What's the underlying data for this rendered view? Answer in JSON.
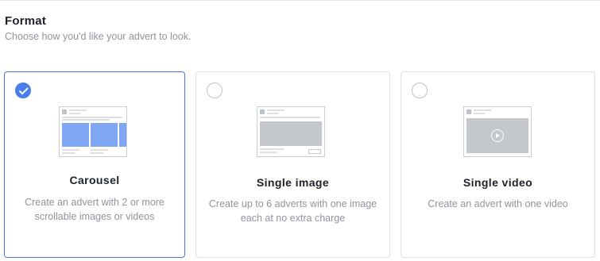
{
  "section": {
    "title": "Format",
    "subtitle": "Choose how you'd like your advert to look."
  },
  "colors": {
    "selected_border": "#4a76d6",
    "check_fill": "#4a7ee8",
    "carousel_image": "#80a7f4",
    "placeholder_gray": "#c4c7cc"
  },
  "options": [
    {
      "title": "Carousel",
      "description": "Create an advert with 2 or more scrollable images or videos",
      "selected": true,
      "icon": "carousel-preview-icon"
    },
    {
      "title": "Single image",
      "description": "Create up to 6 adverts with one image each at no extra charge",
      "selected": false,
      "icon": "single-image-preview-icon"
    },
    {
      "title": "Single video",
      "description": "Create an advert with one video",
      "selected": false,
      "icon": "single-video-preview-icon"
    }
  ]
}
